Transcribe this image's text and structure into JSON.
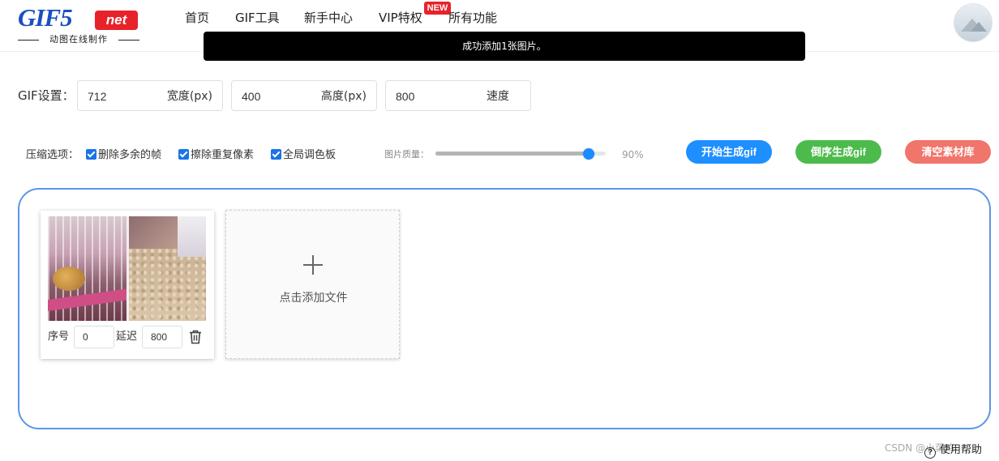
{
  "logo": {
    "main": "GIF5",
    "net": "net",
    "subtitle": "动图在线制作"
  },
  "nav": {
    "items": [
      {
        "label": "首页"
      },
      {
        "label": "GIF工具"
      },
      {
        "label": "新手中心"
      },
      {
        "label": "VIP特权",
        "badge": "NEW"
      },
      {
        "label": "所有功能"
      }
    ]
  },
  "toast": {
    "message": "成功添加1张图片。"
  },
  "gif_settings": {
    "label": "GIF设置：",
    "width": {
      "value": "712",
      "unit": "宽度(px)"
    },
    "height": {
      "value": "400",
      "unit": "高度(px)"
    },
    "speed": {
      "value": "800",
      "unit": "速度"
    }
  },
  "compression": {
    "label": "压缩选项：",
    "options": [
      {
        "label": "删除多余的帧",
        "checked": true
      },
      {
        "label": "擦除重复像素",
        "checked": true
      },
      {
        "label": "全局调色板",
        "checked": true
      }
    ],
    "quality_label": "图片质量：",
    "quality_value": "90%",
    "quality_fraction": 0.9
  },
  "actions": {
    "start": {
      "label": "开始生成gif",
      "color": "#1e8fff"
    },
    "reverse": {
      "label": "倒序生成gif",
      "color": "#4cbb4c"
    },
    "clear": {
      "label": "清空素材库",
      "color": "#f0756a"
    }
  },
  "frames": [
    {
      "order_label": "序号",
      "order": "0",
      "delay_label": "延迟",
      "delay": "800",
      "icon": "trash-icon"
    }
  ],
  "add_file": {
    "label": "点击添加文件",
    "icon": "plus-icon"
  },
  "footer": {
    "watermark": "CSDN @小菜鸡",
    "help": "使用帮助",
    "help_icon": "?"
  }
}
